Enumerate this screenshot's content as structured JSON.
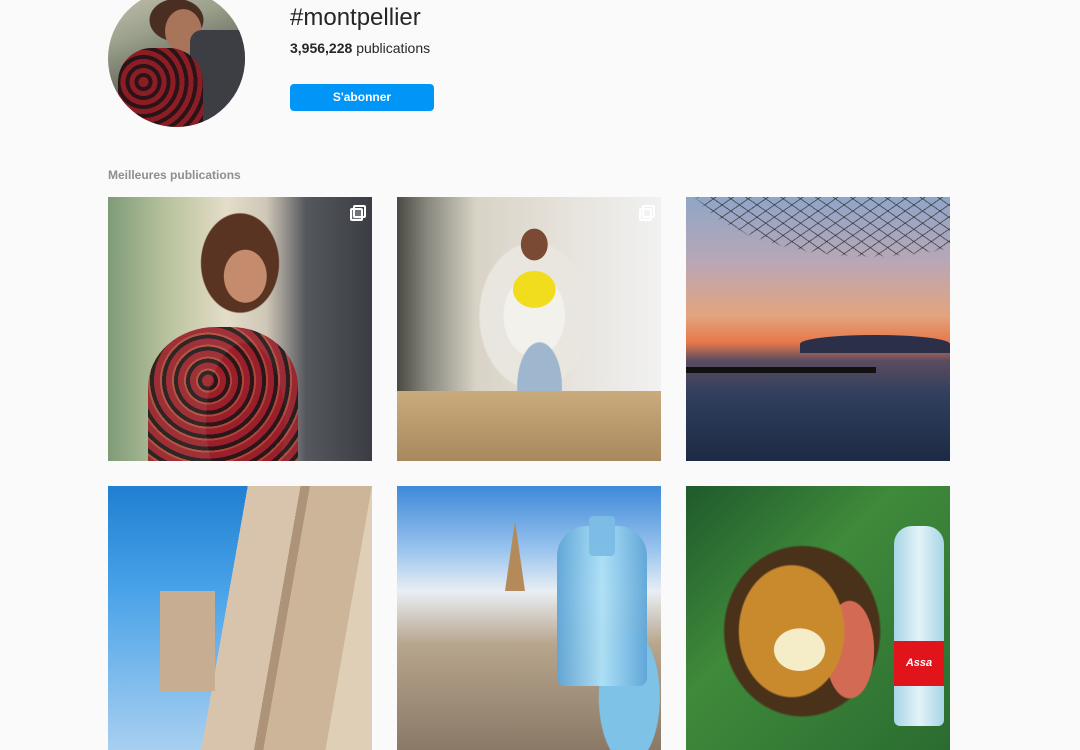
{
  "header": {
    "hashtag": "#montpellier",
    "publication_count": "3,956,228",
    "publication_label": "publications",
    "follow_button": "S'abonner"
  },
  "section": {
    "top_posts_label": "Meilleures publications"
  },
  "posts": [
    {
      "multi": true
    },
    {
      "multi": true
    },
    {
      "multi": false
    },
    {
      "multi": false
    },
    {
      "multi": false
    },
    {
      "multi": false
    }
  ],
  "colors": {
    "accent": "#0095f6",
    "background": "#fafafa",
    "muted_text": "#8e8e8e"
  },
  "post_6_bottle_label": "Assa"
}
